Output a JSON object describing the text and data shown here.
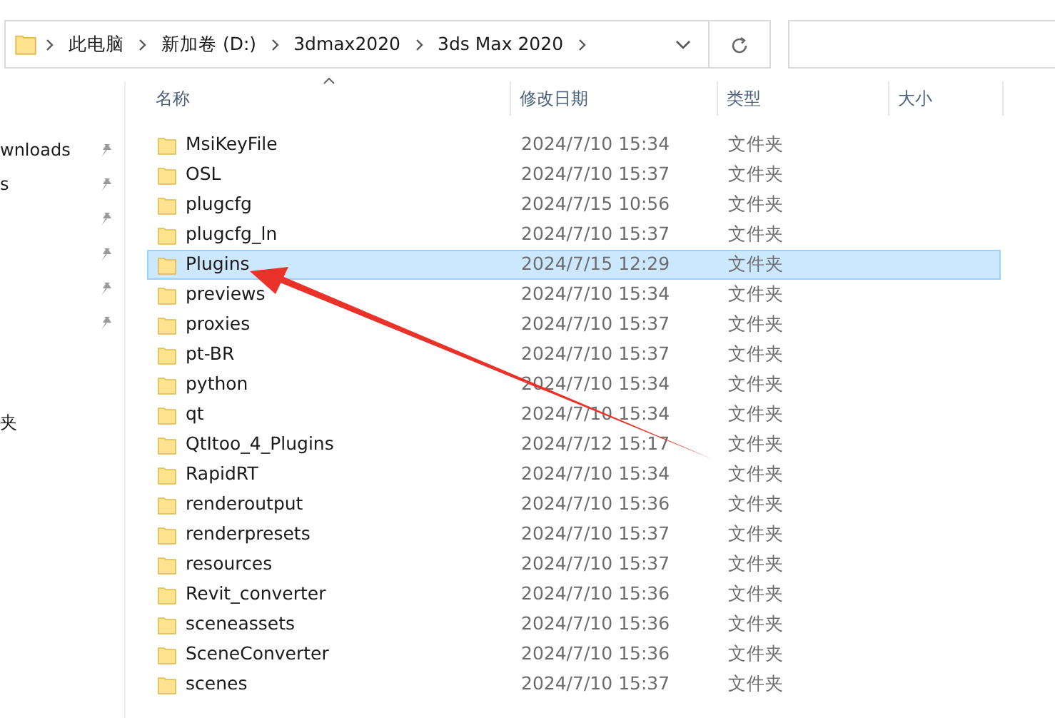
{
  "address_bar": {
    "breadcrumbs": [
      "此电脑",
      "新加卷 (D:)",
      "3dmax2020",
      "3ds Max 2020"
    ]
  },
  "sidebar": {
    "items": [
      {
        "label": "wnloads",
        "pinned": true
      },
      {
        "label": "s",
        "pinned": true
      },
      {
        "pinned": true
      },
      {
        "pinned": true
      },
      {
        "pinned": true
      },
      {
        "pinned": true
      },
      {
        "label": "夹",
        "pinned": false
      }
    ]
  },
  "table": {
    "columns": [
      "名称",
      "修改日期",
      "类型",
      "大小"
    ],
    "rows": [
      {
        "name": "MsiKeyFile",
        "modified": "2024/7/10 15:34",
        "type": "文件夹",
        "selected": false
      },
      {
        "name": "OSL",
        "modified": "2024/7/10 15:37",
        "type": "文件夹",
        "selected": false
      },
      {
        "name": "plugcfg",
        "modified": "2024/7/15 10:56",
        "type": "文件夹",
        "selected": false
      },
      {
        "name": "plugcfg_ln",
        "modified": "2024/7/10 15:37",
        "type": "文件夹",
        "selected": false
      },
      {
        "name": "Plugins",
        "modified": "2024/7/15 12:29",
        "type": "文件夹",
        "selected": true
      },
      {
        "name": "previews",
        "modified": "2024/7/10 15:34",
        "type": "文件夹",
        "selected": false
      },
      {
        "name": "proxies",
        "modified": "2024/7/10 15:37",
        "type": "文件夹",
        "selected": false
      },
      {
        "name": "pt-BR",
        "modified": "2024/7/10 15:37",
        "type": "文件夹",
        "selected": false
      },
      {
        "name": "python",
        "modified": "2024/7/10 15:34",
        "type": "文件夹",
        "selected": false
      },
      {
        "name": "qt",
        "modified": "2024/7/10 15:34",
        "type": "文件夹",
        "selected": false
      },
      {
        "name": "QtItoo_4_Plugins",
        "modified": "2024/7/12 15:17",
        "type": "文件夹",
        "selected": false
      },
      {
        "name": "RapidRT",
        "modified": "2024/7/10 15:34",
        "type": "文件夹",
        "selected": false
      },
      {
        "name": "renderoutput",
        "modified": "2024/7/10 15:36",
        "type": "文件夹",
        "selected": false
      },
      {
        "name": "renderpresets",
        "modified": "2024/7/10 15:37",
        "type": "文件夹",
        "selected": false
      },
      {
        "name": "resources",
        "modified": "2024/7/10 15:37",
        "type": "文件夹",
        "selected": false
      },
      {
        "name": "Revit_converter",
        "modified": "2024/7/10 15:36",
        "type": "文件夹",
        "selected": false
      },
      {
        "name": "sceneassets",
        "modified": "2024/7/10 15:36",
        "type": "文件夹",
        "selected": false
      },
      {
        "name": "SceneConverter",
        "modified": "2024/7/10 15:36",
        "type": "文件夹",
        "selected": false
      },
      {
        "name": "scenes",
        "modified": "2024/7/10 15:37",
        "type": "文件夹",
        "selected": false
      }
    ]
  },
  "annotation": {
    "kind": "arrow"
  }
}
